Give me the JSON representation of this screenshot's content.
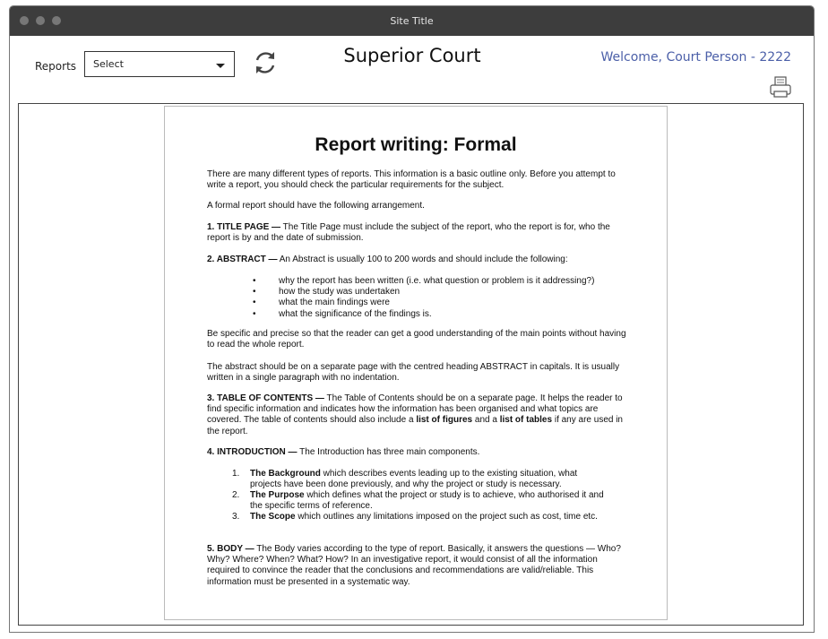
{
  "window": {
    "title": "Site Title"
  },
  "header": {
    "reports_label": "Reports",
    "select_value": "Select",
    "app_title": "Superior Court",
    "welcome": "Welcome, Court Person - 2222"
  },
  "icons": {
    "refresh": "refresh-icon",
    "print": "printer-icon",
    "dropdown": "chevron-down-icon"
  },
  "document": {
    "title": "Report writing: Formal",
    "intro1": "There are many different types of reports. This information is a basic outline only. Before you attempt to write a report, you should check the particular requirements for the subject.",
    "intro2": "A formal report should have the following arrangement.",
    "s1_head": "1.  TITLE PAGE —",
    "s1_text": " The Title Page must include the subject of the report, who the report is for, who the report is by and the date of submission.",
    "s2_head": "2.  ABSTRACT —",
    "s2_text": " An Abstract is usually 100 to 200 words and should include the following:",
    "bullet_char": "•",
    "bullets": [
      "why the report has been written (i.e. what question or problem is it addressing?)",
      "how the study was undertaken",
      "what the main findings were",
      "what the significance of the findings is."
    ],
    "para_specific": "Be specific and precise so that the reader can get a good understanding of the main points without having to read the whole report.",
    "para_abstract": "The abstract should be on a separate page with the centred heading ABSTRACT in capitals. It is usually written in a single paragraph with no indentation.",
    "s3_head": "3.  TABLE OF CONTENTS —",
    "s3_text1": " The Table of Contents should be on a separate page. It helps the reader to find specific information and indicates how the information has been organised and what topics are covered. The table of contents should also include a ",
    "s3_bold1": "list of figures",
    "s3_text2": " and a ",
    "s3_bold2": "list of tables",
    "s3_text3": " if any are used in the report.",
    "s4_head": "4.  INTRODUCTION —",
    "s4_text": " The Introduction has three main components.",
    "numbered": [
      {
        "num": "1.",
        "bold": "The Background",
        "text": " which describes events leading up to the existing situation, what projects have been done previously, and why the project or study is necessary."
      },
      {
        "num": "2.",
        "bold": "The Purpose",
        "text": " which defines what the project or study is to achieve, who authorised it and the specific terms of reference."
      },
      {
        "num": "3.",
        "bold": "The Scope",
        "text": " which outlines any limitations imposed on the project such as cost, time etc."
      }
    ],
    "s5_head": "5.  BODY —",
    "s5_text": " The Body varies according to the type of report. Basically, it answers the questions — Who? Why? Where? When? What? How? In an investigative report, it would consist of all the information required to convince the reader that the conclusions and recommendations are valid/reliable. This information must be presented in a systematic way."
  }
}
